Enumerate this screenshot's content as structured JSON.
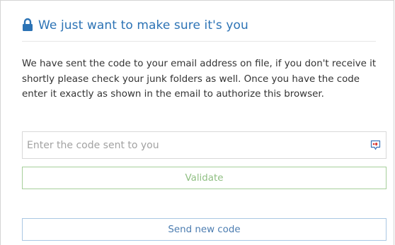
{
  "header": {
    "title": "We just want to make sure it's you",
    "icon": "lock-icon",
    "accent_color": "#2c73b5"
  },
  "message": {
    "text": "We have sent the code to your email address on file, if you don't receive it shortly please check your junk folders as well. Once you have the code enter it exactly as shown in the email to authorize this browser."
  },
  "code_field": {
    "value": "",
    "placeholder": "Enter the code sent to you",
    "autofill_icon": "password-manager-icon"
  },
  "validate_button": {
    "label": "Validate",
    "color": "#8fbf82"
  },
  "send_new_code_button": {
    "label": "Send new code",
    "color": "#4b7cb0"
  }
}
